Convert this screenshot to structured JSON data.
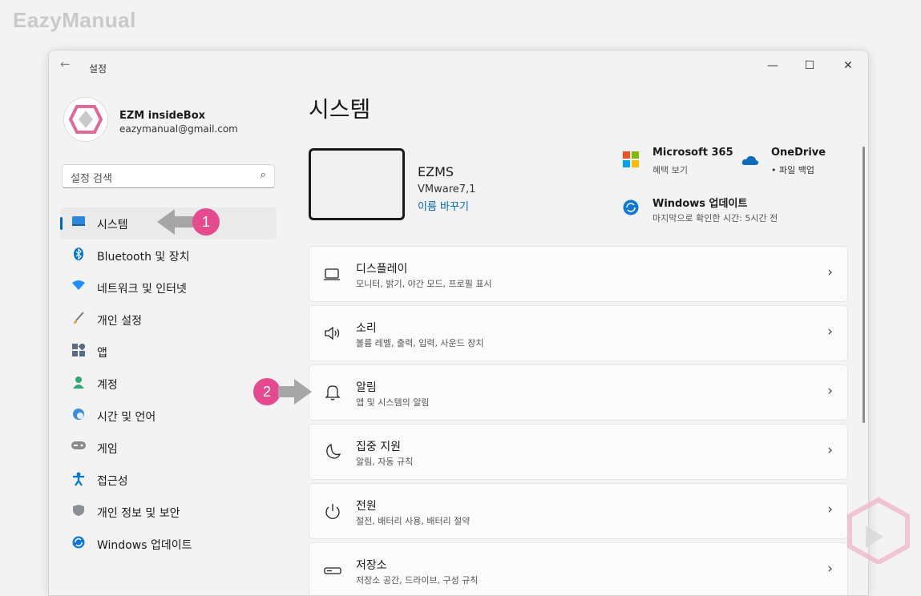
{
  "brand": "EazyManual",
  "window": {
    "title": "설정",
    "back_icon": "back-arrow-icon",
    "min_glyph": "—",
    "max_glyph": "☐",
    "close_glyph": "✕"
  },
  "profile": {
    "name": "EZM insideBox",
    "email": "eazymanual@gmail.com"
  },
  "search": {
    "placeholder": "설정 검색"
  },
  "nav": [
    {
      "label": "시스템",
      "icon": "system-icon",
      "active": true
    },
    {
      "label": "Bluetooth 및 장치",
      "icon": "bluetooth-icon"
    },
    {
      "label": "네트워크 및 인터넷",
      "icon": "network-icon"
    },
    {
      "label": "개인 설정",
      "icon": "brush-icon"
    },
    {
      "label": "앱",
      "icon": "apps-icon"
    },
    {
      "label": "계정",
      "icon": "account-icon"
    },
    {
      "label": "시간 및 언어",
      "icon": "globe-icon"
    },
    {
      "label": "게임",
      "icon": "gamepad-icon"
    },
    {
      "label": "접근성",
      "icon": "accessibility-icon"
    },
    {
      "label": "개인 정보 및 보안",
      "icon": "shield-icon"
    },
    {
      "label": "Windows 업데이트",
      "icon": "update-icon"
    }
  ],
  "main": {
    "title": "시스템",
    "device": {
      "name": "EZMS",
      "model": "VMware7,1",
      "rename": "이름 바꾸기"
    },
    "quick": [
      {
        "title": "Microsoft 365",
        "sub": "혜택 보기",
        "icon": "microsoft-365-icon"
      },
      {
        "title": "OneDrive",
        "sub": "• 파일 백업",
        "icon": "onedrive-icon"
      },
      {
        "title": "Windows 업데이트",
        "sub": "마지막으로 확인한 시간: 5시간 전",
        "icon": "windows-update-icon"
      }
    ],
    "cards": [
      {
        "title": "디스플레이",
        "sub": "모니터, 밝기, 야간 모드, 프로필 표시",
        "icon": "display-icon"
      },
      {
        "title": "소리",
        "sub": "볼륨 레벨, 출력, 입력, 사운드 장치",
        "icon": "speaker-icon"
      },
      {
        "title": "알림",
        "sub": "앱 및 시스템의 알림",
        "icon": "bell-icon"
      },
      {
        "title": "집중 지원",
        "sub": "알림, 자동 규칙",
        "icon": "moon-icon"
      },
      {
        "title": "전원",
        "sub": "절전, 배터리 사용, 배터리 절약",
        "icon": "power-icon"
      },
      {
        "title": "저장소",
        "sub": "저장소 공간, 드라이브, 구성 규칙",
        "icon": "storage-icon"
      }
    ]
  },
  "annotations": {
    "step1": "1",
    "step2": "2"
  },
  "colors": {
    "accent": "#0067c0",
    "badge": "#e64a8e",
    "arrow": "#a6a6a6"
  }
}
